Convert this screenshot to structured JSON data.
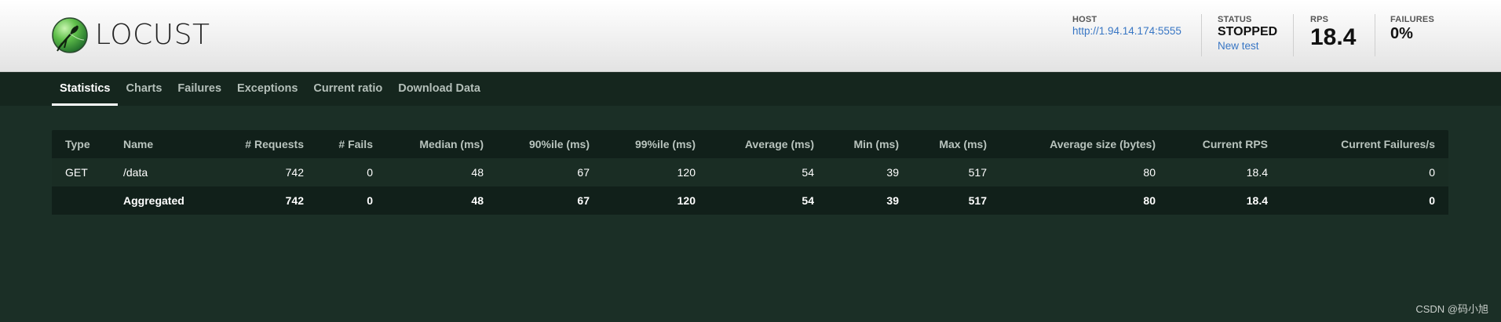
{
  "header": {
    "logo_text": "LOCUST",
    "host": {
      "label": "HOST",
      "value": "http://1.94.14.174:5555"
    },
    "status": {
      "label": "STATUS",
      "value": "STOPPED",
      "new_test_label": "New test"
    },
    "rps": {
      "label": "RPS",
      "value": "18.4"
    },
    "failures": {
      "label": "FAILURES",
      "value": "0%"
    }
  },
  "nav": {
    "tabs": [
      {
        "label": "Statistics",
        "active": true
      },
      {
        "label": "Charts"
      },
      {
        "label": "Failures"
      },
      {
        "label": "Exceptions"
      },
      {
        "label": "Current ratio"
      },
      {
        "label": "Download Data"
      }
    ]
  },
  "stats": {
    "columns": [
      "Type",
      "Name",
      "# Requests",
      "# Fails",
      "Median (ms)",
      "90%ile (ms)",
      "99%ile (ms)",
      "Average (ms)",
      "Min (ms)",
      "Max (ms)",
      "Average size (bytes)",
      "Current RPS",
      "Current Failures/s"
    ],
    "rows": [
      [
        "GET",
        "/data",
        "742",
        "0",
        "48",
        "67",
        "120",
        "54",
        "39",
        "517",
        "80",
        "18.4",
        "0"
      ]
    ],
    "aggregated": [
      "",
      "Aggregated",
      "742",
      "0",
      "48",
      "67",
      "120",
      "54",
      "39",
      "517",
      "80",
      "18.4",
      "0"
    ]
  },
  "watermark": "CSDN @码小旭",
  "colors": {
    "background": "#1b2f26",
    "nav_background": "#15261e",
    "table_background": "#11201a",
    "link": "#3876c4"
  }
}
